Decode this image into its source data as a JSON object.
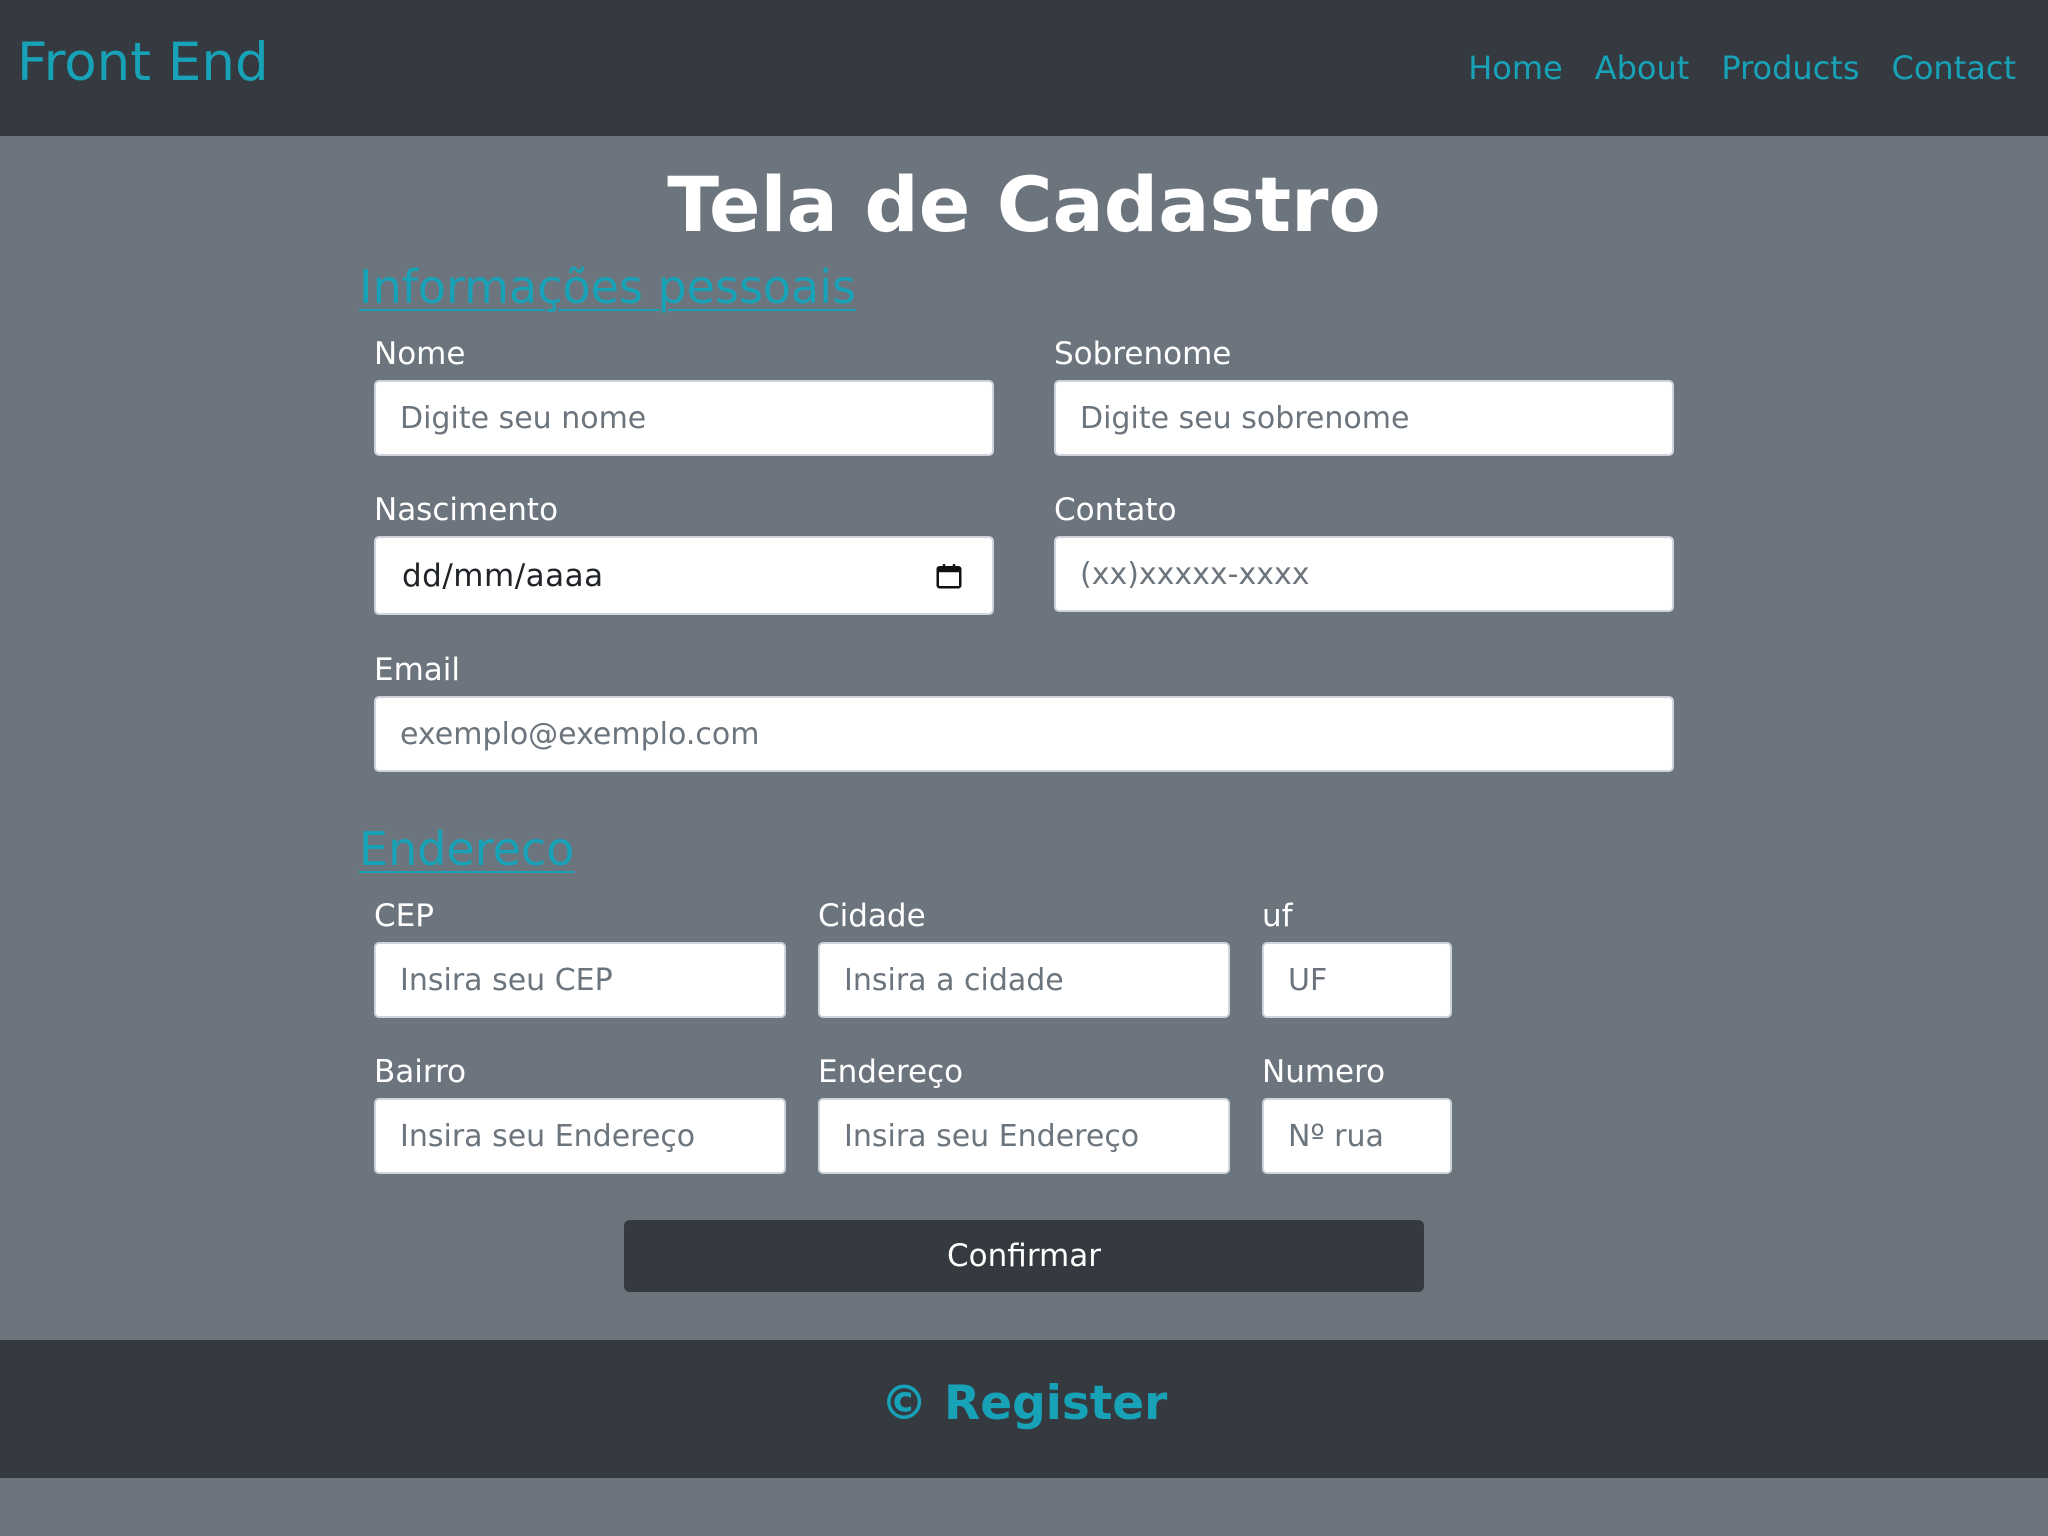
{
  "navbar": {
    "brand": "Front End",
    "links": [
      {
        "label": "Home"
      },
      {
        "label": "About"
      },
      {
        "label": "Products"
      },
      {
        "label": "Contact"
      }
    ]
  },
  "page": {
    "title": "Tela de Cadastro"
  },
  "personal": {
    "section_title": "Informações pessoais",
    "nome": {
      "label": "Nome",
      "placeholder": "Digite seu nome"
    },
    "sobrenome": {
      "label": "Sobrenome",
      "placeholder": "Digite seu sobrenome"
    },
    "nascimento": {
      "label": "Nascimento",
      "value": "dd/mm/aaaa"
    },
    "contato": {
      "label": "Contato",
      "placeholder": "(xx)xxxxx-xxxx"
    },
    "email": {
      "label": "Email",
      "placeholder": "exemplo@exemplo.com"
    }
  },
  "address": {
    "section_title": "Endereco",
    "cep": {
      "label": "CEP",
      "placeholder": "Insira seu CEP"
    },
    "cidade": {
      "label": "Cidade",
      "placeholder": "Insira a cidade"
    },
    "uf": {
      "label": "uf",
      "placeholder": "UF"
    },
    "bairro": {
      "label": "Bairro",
      "placeholder": "Insira seu Endereço"
    },
    "endereco": {
      "label": "Endereço",
      "placeholder": "Insira seu Endereço"
    },
    "numero": {
      "label": "Numero",
      "placeholder": "Nº rua"
    }
  },
  "form": {
    "confirm_label": "Confirmar"
  },
  "footer": {
    "text": "© Register"
  },
  "colors": {
    "navbar_bg": "#343a40",
    "page_bg": "#6c757d",
    "accent": "#17a2b8"
  },
  "icons": {
    "calendar": "calendar-icon"
  }
}
